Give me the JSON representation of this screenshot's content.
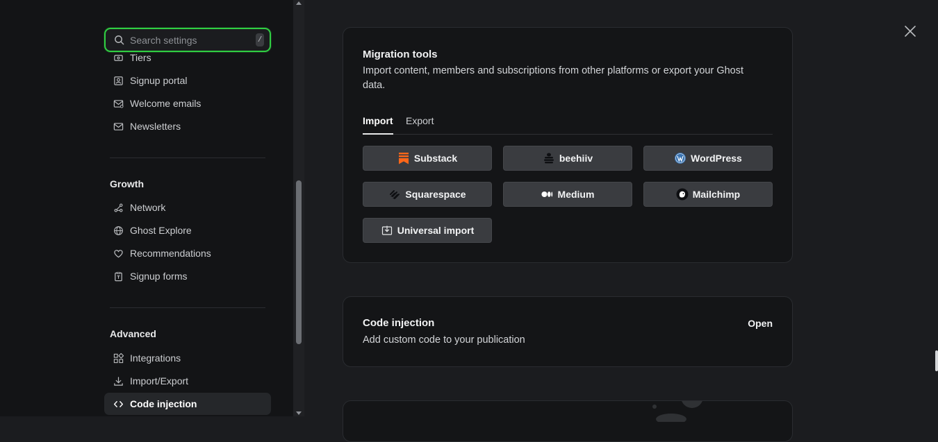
{
  "search": {
    "placeholder": "Search settings",
    "shortcut": "/"
  },
  "sidebar": {
    "membership_items": [
      {
        "label": "Tiers",
        "icon": "tiers-icon"
      },
      {
        "label": "Signup portal",
        "icon": "portal-icon"
      },
      {
        "label": "Welcome emails",
        "icon": "welcome-email-icon"
      },
      {
        "label": "Newsletters",
        "icon": "mail-icon"
      }
    ],
    "growth": {
      "title": "Growth",
      "items": [
        {
          "label": "Network",
          "icon": "network-icon"
        },
        {
          "label": "Ghost Explore",
          "icon": "globe-icon"
        },
        {
          "label": "Recommendations",
          "icon": "heart-icon"
        },
        {
          "label": "Signup forms",
          "icon": "form-icon"
        }
      ]
    },
    "advanced": {
      "title": "Advanced",
      "items": [
        {
          "label": "Integrations",
          "icon": "integrations-icon"
        },
        {
          "label": "Import/Export",
          "icon": "download-icon"
        },
        {
          "label": "Code injection",
          "icon": "code-icon"
        }
      ]
    }
  },
  "migration": {
    "title": "Migration tools",
    "description": "Import content, members and subscriptions from other platforms or export your Ghost data.",
    "tabs": [
      {
        "label": "Import"
      },
      {
        "label": "Export"
      }
    ],
    "buttons": [
      {
        "label": "Substack",
        "icon": "substack-icon"
      },
      {
        "label": "beehiiv",
        "icon": "beehiiv-icon"
      },
      {
        "label": "WordPress",
        "icon": "wordpress-icon"
      },
      {
        "label": "Squarespace",
        "icon": "squarespace-icon"
      },
      {
        "label": "Medium",
        "icon": "medium-icon"
      },
      {
        "label": "Mailchimp",
        "icon": "mailchimp-icon"
      },
      {
        "label": "Universal import",
        "icon": "import-icon"
      }
    ]
  },
  "code_injection": {
    "title": "Code injection",
    "description": "Add custom code to your publication",
    "action": "Open"
  },
  "colors": {
    "search_focus": "#30cf43",
    "substack": "#ff6719",
    "wordpress": "#3a73b0"
  }
}
